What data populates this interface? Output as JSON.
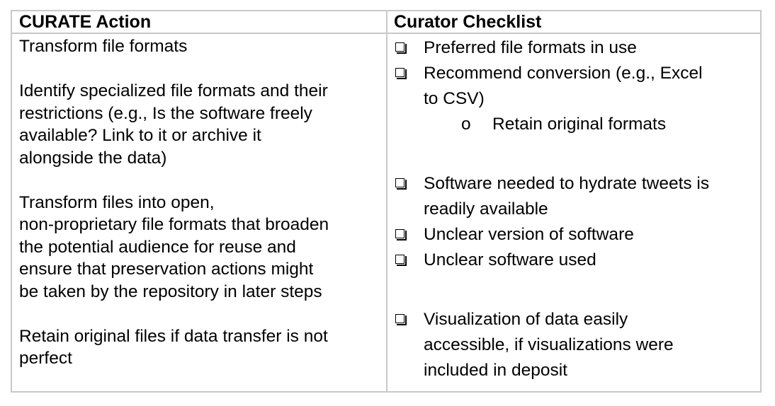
{
  "table": {
    "headers": {
      "action": "CURATE Action",
      "checklist": "Curator Checklist"
    },
    "left": {
      "p1": "Transform file formats",
      "p2": [
        "Identify specialized file formats and their",
        "restrictions (e.g., Is the software freely",
        "available? Link to it or archive it",
        "alongside the data)"
      ],
      "p3": [
        "Transform files into open,",
        "non-proprietary file formats that broaden",
        "the potential audience for reuse and",
        "ensure that preservation actions might",
        "be taken by the repository in later steps"
      ],
      "p4": [
        "Retain original files if data transfer is not",
        "perfect"
      ]
    },
    "right": {
      "item1": "Preferred file formats in use",
      "item2": [
        "Recommend conversion (e.g., Excel",
        "to CSV)"
      ],
      "sub_bullet": "o",
      "sub1": "Retain original formats",
      "item3": [
        "Software needed to hydrate tweets is",
        "readily available"
      ],
      "item4": "Unclear version of software",
      "item5": "Unclear software used",
      "item6": [
        "Visualization of data easily",
        "accessible, if visualizations were",
        "included in deposit"
      ]
    }
  }
}
